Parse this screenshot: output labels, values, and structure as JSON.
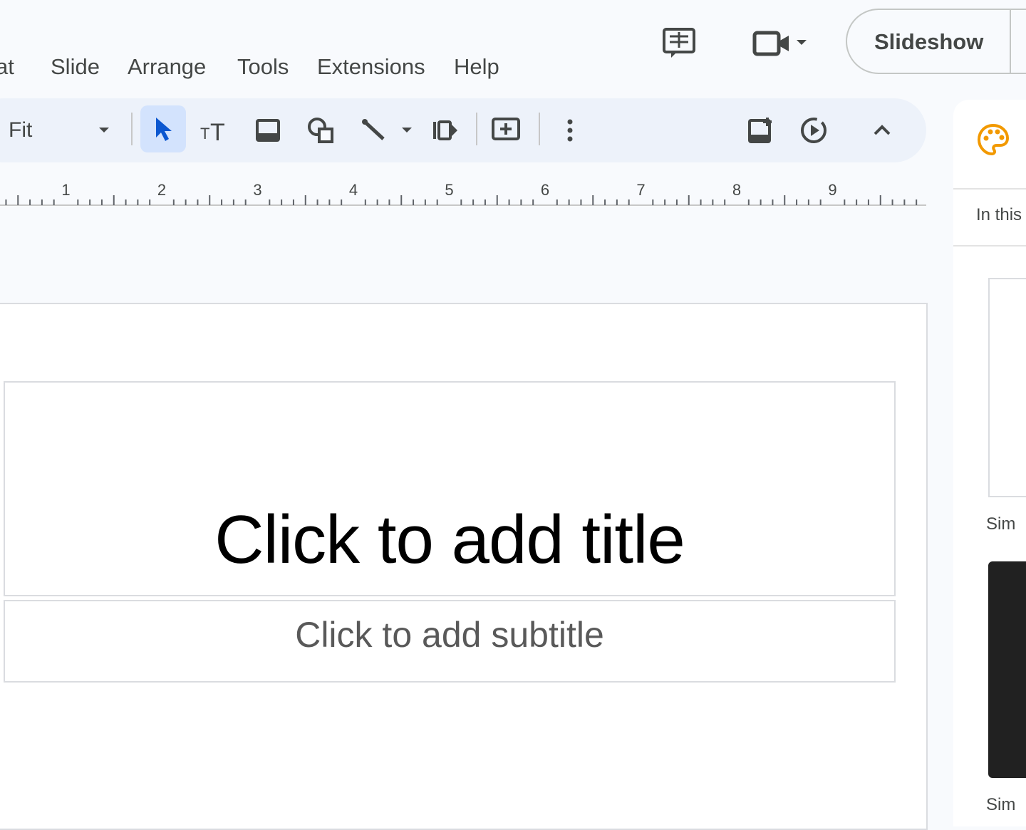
{
  "menu": {
    "items": [
      "at",
      "Slide",
      "Arrange",
      "Tools",
      "Extensions",
      "Help"
    ]
  },
  "header": {
    "slideshow_label": "Slideshow",
    "icons": [
      "comment-history-icon",
      "video-camera-icon",
      "dropdown-icon"
    ]
  },
  "toolbar": {
    "zoom_value": "Fit",
    "tools": [
      "select-tool",
      "text-box-tool",
      "image-tool",
      "shape-tool",
      "line-tool",
      "line-dropdown",
      "transition-tool",
      "comment-tool",
      "more-tool",
      "add-slide-tool",
      "motion-tool",
      "collapse-toolbar"
    ]
  },
  "ruler": {
    "labels": [
      "1",
      "2",
      "3",
      "4",
      "5",
      "6",
      "7",
      "8",
      "9"
    ]
  },
  "slide": {
    "title_placeholder": "Click to add title",
    "subtitle_placeholder": "Click to add subtitle"
  },
  "theme_panel": {
    "section_label": "In this",
    "theme_labels": [
      "Sim",
      "Sim"
    ]
  },
  "colors": {
    "accent": "#0b57d0",
    "theme_icon": "#f29900",
    "toolbar_bg": "#edf2fa",
    "selected_tool_bg": "#d3e3fd"
  }
}
